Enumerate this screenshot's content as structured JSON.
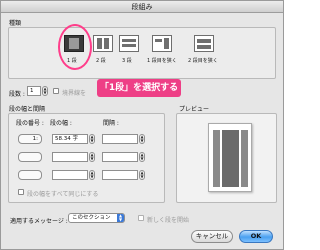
{
  "window": {
    "title": "段組み"
  },
  "type_section": {
    "heading": "種類",
    "options": [
      {
        "label": "1 段",
        "selected": true
      },
      {
        "label": "2 段",
        "selected": false
      },
      {
        "label": "3 段",
        "selected": false
      },
      {
        "label": "1 段目を狭く",
        "selected": false
      },
      {
        "label": "2 段目を狭く",
        "selected": false
      }
    ]
  },
  "columns": {
    "label": "段数 :",
    "value": "1",
    "equal_width_label": "境界線を"
  },
  "callout": {
    "text": "「1段」を選択する"
  },
  "width_section": {
    "heading": "段の幅と間隔",
    "col_no_label": "段の番号 :",
    "width_label": "段の幅 :",
    "spacing_label": "間隔 :",
    "rows": [
      {
        "no": "1:",
        "width": "58.34 字",
        "spacing": ""
      },
      {
        "no": "",
        "width": "",
        "spacing": ""
      },
      {
        "no": "",
        "width": "",
        "spacing": ""
      }
    ],
    "equal_width_checkbox": "段の幅をすべて同じにする"
  },
  "preview": {
    "heading": "プレビュー"
  },
  "footer": {
    "apply_label": "適用するメッセージ :",
    "apply_value": "このセクション",
    "new_column_label": "新しく段を開始",
    "cancel": "キャンセル",
    "ok": "OK"
  },
  "colors": {
    "accent": "#ee3f86",
    "ok_button": "#4aa0f0"
  }
}
